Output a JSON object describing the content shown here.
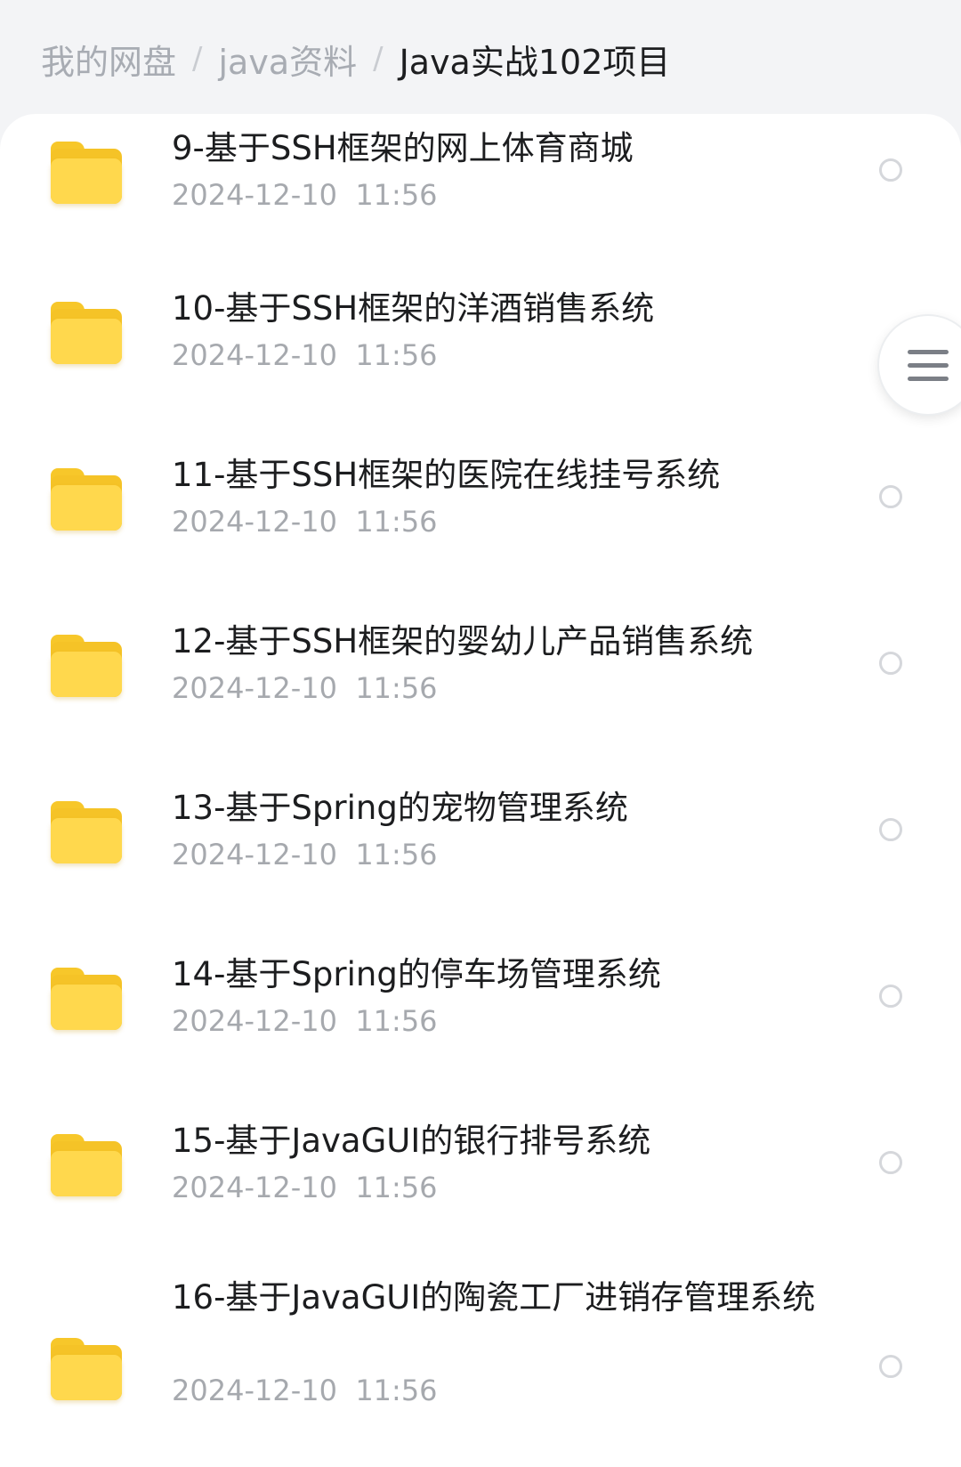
{
  "breadcrumb": {
    "root": "我的网盘",
    "folder": "java资料",
    "current": "Java实战102项目",
    "separator": "/"
  },
  "files": [
    {
      "name": "9-基于SSH框架的网上体育商城",
      "time": "2024-12-10  11:56"
    },
    {
      "name": "10-基于SSH框架的洋酒销售系统",
      "time": "2024-12-10  11:56"
    },
    {
      "name": "11-基于SSH框架的医院在线挂号系统",
      "time": "2024-12-10  11:56"
    },
    {
      "name": "12-基于SSH框架的婴幼儿产品销售系统",
      "time": "2024-12-10  11:56"
    },
    {
      "name": "13-基于Spring的宠物管理系统",
      "time": "2024-12-10  11:56"
    },
    {
      "name": "14-基于Spring的停车场管理系统",
      "time": "2024-12-10  11:56"
    },
    {
      "name": "15-基于JavaGUI的银行排号系统",
      "time": "2024-12-10  11:56"
    },
    {
      "name": "16-基于JavaGUI的陶瓷工厂进销存管理系统",
      "time": "2024-12-10  11:56"
    }
  ],
  "icons": {
    "file": "folder-icon",
    "select": "radio-circle-icon",
    "menu": "hamburger-menu-icon"
  },
  "colors": {
    "folder": "#ffd84d",
    "title": "#1c1d1f",
    "meta": "#a6a9ae",
    "breadcrumb_inactive": "#a8acb3"
  }
}
